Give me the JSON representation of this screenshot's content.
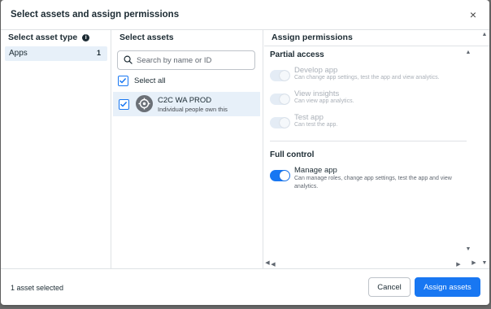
{
  "dialog": {
    "title": "Select assets and assign permissions",
    "close_label": "×"
  },
  "asset_type_column": {
    "header": "Select asset type",
    "items": [
      {
        "label": "Apps",
        "count": "1"
      }
    ]
  },
  "assets_column": {
    "header": "Select assets",
    "search_placeholder": "Search by name or ID",
    "select_all_label": "Select all",
    "assets": [
      {
        "name": "C2C WA PROD",
        "subtitle": "Individual people own this"
      }
    ]
  },
  "permissions_column": {
    "header": "Assign permissions",
    "partial_access": {
      "title": "Partial access",
      "items": [
        {
          "name": "Develop app",
          "description": "Can change app settings, test the app and view analytics."
        },
        {
          "name": "View insights",
          "description": "Can view app analytics."
        },
        {
          "name": "Test app",
          "description": "Can test the app."
        }
      ]
    },
    "full_control": {
      "title": "Full control",
      "items": [
        {
          "name": "Manage app",
          "description": "Can manage roles, change app settings, test the app and view analytics."
        }
      ]
    }
  },
  "footer": {
    "status": "1 asset selected",
    "cancel_label": "Cancel",
    "submit_label": "Assign assets"
  },
  "colors": {
    "accent": "#1877f2",
    "selected_bg": "#e7f0f9"
  }
}
